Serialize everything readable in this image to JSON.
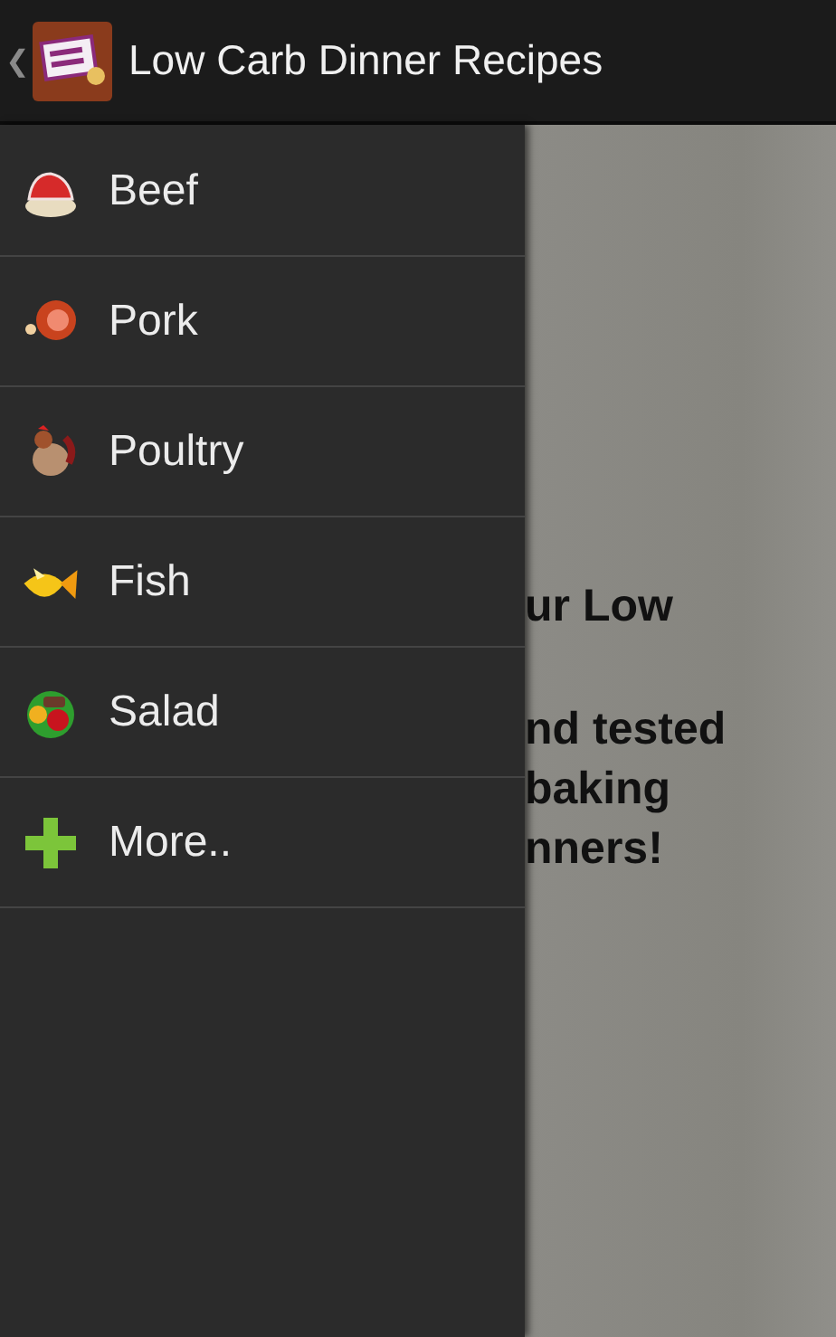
{
  "action_bar": {
    "back": "❮",
    "title": "Low Carb Dinner Recipes"
  },
  "drawer": {
    "items": [
      {
        "label": "Beef"
      },
      {
        "label": "Pork"
      },
      {
        "label": "Poultry"
      },
      {
        "label": "Fish"
      },
      {
        "label": "Salad"
      },
      {
        "label": "More.."
      }
    ]
  },
  "content": {
    "paragraphs": [
      [
        "ur Low"
      ],
      [
        "nd tested",
        "baking",
        "nners!"
      ]
    ]
  }
}
